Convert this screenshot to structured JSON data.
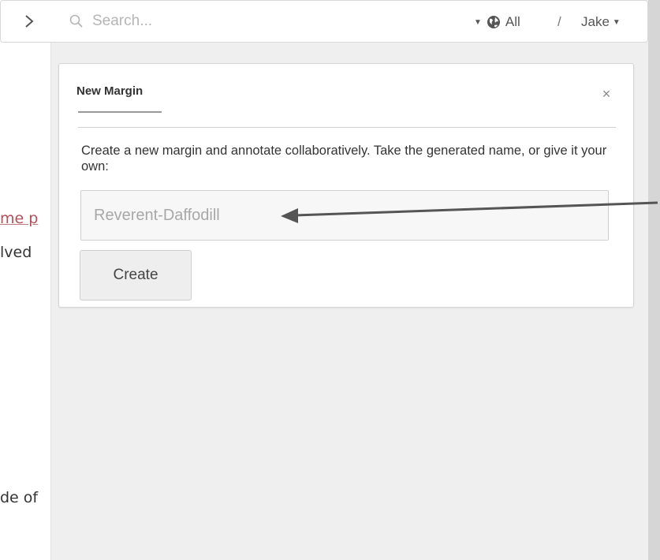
{
  "background_document": {
    "lines": [
      {
        "text": "me p",
        "is_link": true
      },
      {
        "text": "lved",
        "is_link": false
      },
      {
        "text": "de of",
        "is_link": false
      }
    ]
  },
  "topbar": {
    "expand_icon": "chevron-right-icon",
    "search": {
      "icon": "search-icon",
      "placeholder": "Search..."
    },
    "scope": {
      "icon": "globe-icon",
      "label": "All"
    },
    "separator": "/",
    "user": {
      "label": "Jake"
    }
  },
  "dialog": {
    "tab_label": "New Margin",
    "close_label": "×",
    "description": "Create a new margin and annotate collaboratively. Take the generated name, or give it your own:",
    "name_input": {
      "placeholder": "Reverent-Daffodill",
      "value": ""
    },
    "create_label": "Create"
  },
  "colors": {
    "link": "#b0525a",
    "sidebar_bg": "#efefef",
    "arrow": "#555555"
  }
}
